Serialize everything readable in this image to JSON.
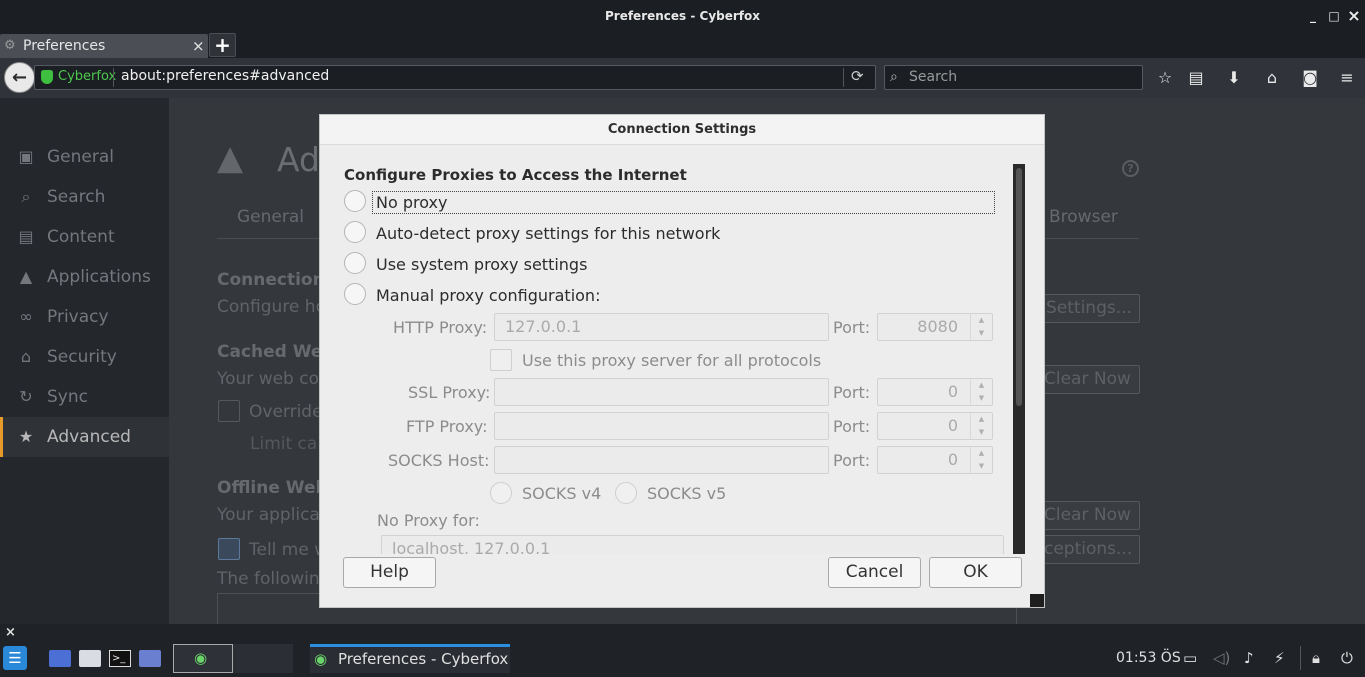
{
  "window": {
    "title": "Preferences - Cyberfox",
    "minimize": "_",
    "maximize": "□",
    "close": "×"
  },
  "tabs": [
    {
      "label": "Preferences",
      "close": "×"
    }
  ],
  "newtab": "+",
  "navbar": {
    "identity": "Cyberfox",
    "url": "about:preferences#advanced",
    "search_placeholder": "Search"
  },
  "sidebar": {
    "items": [
      {
        "label": "General",
        "icon": "general-icon"
      },
      {
        "label": "Search",
        "icon": "search-icon"
      },
      {
        "label": "Content",
        "icon": "content-icon"
      },
      {
        "label": "Applications",
        "icon": "applications-icon"
      },
      {
        "label": "Privacy",
        "icon": "privacy-icon"
      },
      {
        "label": "Security",
        "icon": "security-icon"
      },
      {
        "label": "Sync",
        "icon": "sync-icon"
      },
      {
        "label": "Advanced",
        "icon": "advanced-icon",
        "active": true
      }
    ]
  },
  "pane": {
    "heading": "Ad",
    "help": "?",
    "tab_general": "General",
    "tab_browser": "Browser",
    "connection_heading": "Connection",
    "connection_desc": "Configure ho",
    "settings_btn": "Settings...",
    "cached_heading": "Cached We",
    "cached_desc": "Your web co",
    "clear_now": "Clear Now",
    "override": "Override",
    "limit": "Limit ca",
    "offline_heading": "Offline Web",
    "offline_desc": "Your applica",
    "clear_now2": "Clear Now",
    "tell_me": "Tell me w",
    "exceptions_btn": "ceptions...",
    "following": "The followin"
  },
  "dialog": {
    "title": "Connection Settings",
    "heading": "Configure Proxies to Access the Internet",
    "no_proxy": "No proxy",
    "auto_detect": "Auto-detect proxy settings for this network",
    "system": "Use system proxy settings",
    "manual": "Manual proxy configuration:",
    "http_label": "HTTP Proxy:",
    "http_value": "127.0.0.1",
    "port_label": "Port:",
    "http_port": "8080",
    "use_all": "Use this proxy server for all protocols",
    "ssl_label": "SSL Proxy:",
    "ssl_port": "0",
    "ftp_label": "FTP Proxy:",
    "ftp_port": "0",
    "socks_label": "SOCKS Host:",
    "socks_port": "0",
    "socks_v4": "SOCKS v4",
    "socks_v5": "SOCKS v5",
    "no_proxy_for": "No Proxy for:",
    "no_proxy_value": "localhost, 127.0.0.1",
    "help_btn": "Help",
    "cancel_btn": "Cancel",
    "ok_btn": "OK"
  },
  "taskbar": {
    "close": "×",
    "task_label": "Preferences - Cyberfox",
    "clock": "01:53 ÖS"
  }
}
